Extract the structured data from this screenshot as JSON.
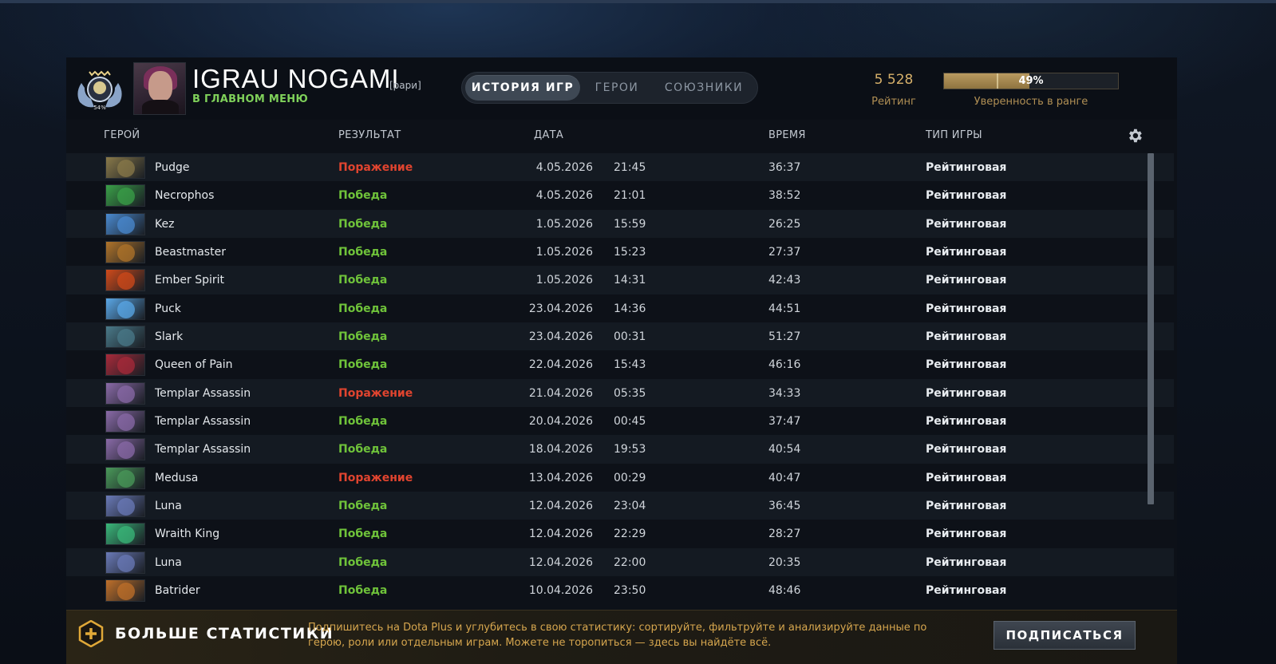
{
  "profile": {
    "name": "IGRAU NOGAMI",
    "tag": "[рари]",
    "status": "В ГЛАВНОМ МЕНЮ",
    "rank_medal_text": "54%"
  },
  "tabs": [
    {
      "label": "ИСТОРИЯ ИГР",
      "active": true
    },
    {
      "label": "ГЕРОИ",
      "active": false
    },
    {
      "label": "СОЮЗНИКИ",
      "active": false
    }
  ],
  "rating": {
    "value": "5 528",
    "label": "Рейтинг",
    "confidence_percent": 49,
    "confidence_text": "49%",
    "confidence_label": "Уверенность в ранге"
  },
  "columns": {
    "hero": "ГЕРОЙ",
    "result": "РЕЗУЛЬТАТ",
    "date": "ДАТА",
    "duration": "ВРЕМЯ",
    "game_type": "ТИП ИГРЫ"
  },
  "matches": [
    {
      "hero": "Pudge",
      "result": "Поражение",
      "win": false,
      "date": "4.05.2026",
      "time": "21:45",
      "duration": "36:37",
      "type": "Рейтинговая",
      "icon_color": "#8a7a4a"
    },
    {
      "hero": "Necrophos",
      "result": "Победа",
      "win": true,
      "date": "4.05.2026",
      "time": "21:01",
      "duration": "38:52",
      "type": "Рейтинговая",
      "icon_color": "#3aa048"
    },
    {
      "hero": "Kez",
      "result": "Победа",
      "win": true,
      "date": "1.05.2026",
      "time": "15:59",
      "duration": "26:25",
      "type": "Рейтинговая",
      "icon_color": "#4a8ad0"
    },
    {
      "hero": "Beastmaster",
      "result": "Победа",
      "win": true,
      "date": "1.05.2026",
      "time": "15:23",
      "duration": "27:37",
      "type": "Рейтинговая",
      "icon_color": "#b0742a"
    },
    {
      "hero": "Ember Spirit",
      "result": "Победа",
      "win": true,
      "date": "1.05.2026",
      "time": "14:31",
      "duration": "42:43",
      "type": "Рейтинговая",
      "icon_color": "#d04a1a"
    },
    {
      "hero": "Puck",
      "result": "Победа",
      "win": true,
      "date": "23.04.2026",
      "time": "14:36",
      "duration": "44:51",
      "type": "Рейтинговая",
      "icon_color": "#5aa8e8"
    },
    {
      "hero": "Slark",
      "result": "Победа",
      "win": true,
      "date": "23.04.2026",
      "time": "00:31",
      "duration": "51:27",
      "type": "Рейтинговая",
      "icon_color": "#4a7a8a"
    },
    {
      "hero": "Queen of Pain",
      "result": "Победа",
      "win": true,
      "date": "22.04.2026",
      "time": "15:43",
      "duration": "46:16",
      "type": "Рейтинговая",
      "icon_color": "#a82a3a"
    },
    {
      "hero": "Templar Assassin",
      "result": "Поражение",
      "win": false,
      "date": "21.04.2026",
      "time": "05:35",
      "duration": "34:33",
      "type": "Рейтинговая",
      "icon_color": "#8a6aa8"
    },
    {
      "hero": "Templar Assassin",
      "result": "Победа",
      "win": true,
      "date": "20.04.2026",
      "time": "00:45",
      "duration": "37:47",
      "type": "Рейтинговая",
      "icon_color": "#8a6aa8"
    },
    {
      "hero": "Templar Assassin",
      "result": "Победа",
      "win": true,
      "date": "18.04.2026",
      "time": "19:53",
      "duration": "40:54",
      "type": "Рейтинговая",
      "icon_color": "#8a6aa8"
    },
    {
      "hero": "Medusa",
      "result": "Поражение",
      "win": false,
      "date": "13.04.2026",
      "time": "00:29",
      "duration": "40:47",
      "type": "Рейтинговая",
      "icon_color": "#4a9a5a"
    },
    {
      "hero": "Luna",
      "result": "Победа",
      "win": true,
      "date": "12.04.2026",
      "time": "23:04",
      "duration": "36:45",
      "type": "Рейтинговая",
      "icon_color": "#6a7ab8"
    },
    {
      "hero": "Wraith King",
      "result": "Победа",
      "win": true,
      "date": "12.04.2026",
      "time": "22:29",
      "duration": "28:27",
      "type": "Рейтинговая",
      "icon_color": "#3ab87a"
    },
    {
      "hero": "Luna",
      "result": "Победа",
      "win": true,
      "date": "12.04.2026",
      "time": "22:00",
      "duration": "20:35",
      "type": "Рейтинговая",
      "icon_color": "#6a7ab8"
    },
    {
      "hero": "Batrider",
      "result": "Победа",
      "win": true,
      "date": "10.04.2026",
      "time": "23:50",
      "duration": "48:46",
      "type": "Рейтинговая",
      "icon_color": "#c0702a"
    }
  ],
  "promo": {
    "title": "БОЛЬШЕ СТАТИСТИКИ",
    "text": "Подпишитесь на Dota Plus и углубитесь в свою статистику: сортируйте, фильтруйте и анализируйте данные по герою, роли или отдельным играм. Можете не торопиться — здесь вы найдёте всё.",
    "button": "ПОДПИСАТЬСЯ"
  },
  "colors": {
    "win": "#6fc33a",
    "loss": "#e0442f",
    "gold": "#d6b06a"
  }
}
